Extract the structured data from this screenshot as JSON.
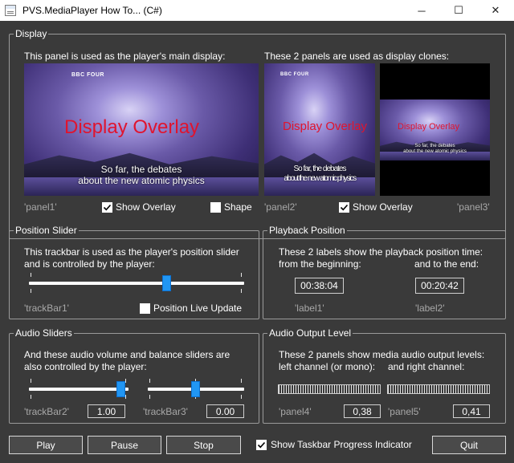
{
  "window": {
    "title": "PVS.MediaPlayer How To... (C#)",
    "minimize_glyph": "─",
    "maximize_glyph": "☐",
    "close_glyph": "✕"
  },
  "display_group": {
    "legend": "Display",
    "main_desc": "This panel is used as the player's main display:",
    "clone_desc": "These 2 panels are used as display clones:",
    "overlay_text": "Display Overlay",
    "subtitle_line1": "So far, the debates",
    "subtitle_line2": "about the new atomic physics",
    "channel_logo": "BBC FOUR",
    "panel1_label": "'panel1'",
    "panel2_label": "'panel2'",
    "panel3_label": "'panel3'",
    "show_overlay_label": "Show Overlay",
    "show_overlay_checked": true,
    "shape_label": "Shape",
    "shape_checked": false,
    "show_overlay2_label": "Show Overlay",
    "show_overlay2_checked": true
  },
  "position_group": {
    "legend": "Position Slider",
    "desc_line1": "This trackbar is used as the player's position slider",
    "desc_line2": "and is controlled by the player:",
    "trackbar_label": "'trackBar1'",
    "live_update_label": "Position Live Update",
    "live_update_checked": false,
    "position_fraction": 0.6
  },
  "playback_group": {
    "legend": "Playback Position",
    "desc_line1": "These 2 labels show the playback position time:",
    "from_label": "from the beginning:",
    "to_label": "and to the end:",
    "label1_value": "00:38:04",
    "label2_value": "00:20:42",
    "label1_name": "'label1'",
    "label2_name": "'label2'"
  },
  "audio_sliders_group": {
    "legend": "Audio Sliders",
    "desc_line1": "And these audio volume and balance sliders are",
    "desc_line2": "also controlled by the player:",
    "trackbar2_label": "'trackBar2'",
    "trackbar2_value": "1.00",
    "trackbar3_label": "'trackBar3'",
    "trackbar3_value": "0.00",
    "volume_fraction": 1.0,
    "balance_fraction": 0.5
  },
  "audio_level_group": {
    "legend": "Audio Output Level",
    "desc_line1": "These 2 panels show media audio output levels:",
    "left_label": "left channel (or mono):",
    "right_label": "and right channel:",
    "panel4_label": "'panel4'",
    "panel4_value": "0,38",
    "panel5_label": "'panel5'",
    "panel5_value": "0,41"
  },
  "bottom_bar": {
    "play_label": "Play",
    "pause_label": "Pause",
    "stop_label": "Stop",
    "taskbar_progress_label": "Show Taskbar Progress Indicator",
    "taskbar_progress_checked": true,
    "quit_label": "Quit"
  }
}
